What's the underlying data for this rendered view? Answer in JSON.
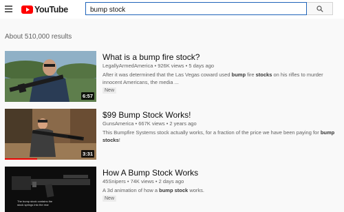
{
  "app": {
    "logo_text": "YouTube"
  },
  "search": {
    "query": "bump stock"
  },
  "results_count": "About 510,000 results",
  "results": [
    {
      "title": "What is a bump fire stock?",
      "channel": "LegallyArmedAmerica",
      "views": "926K views",
      "age": "5 days ago",
      "desc_parts": [
        "After it was determined that the Las Vegas coward used ",
        "bump",
        " fire ",
        "stocks",
        " on his rifles to murder innocent Americans, the media ..."
      ],
      "badge": "New",
      "duration": "6:57",
      "watched_fraction": 0
    },
    {
      "title": "$99 Bump Stock Works!",
      "channel": "GunsAmerica",
      "views": "667K views",
      "age": "2 years ago",
      "desc_parts": [
        "This Bumpfire Systems stock actually works, for a fraction of the price we have been paying for ",
        "bump",
        " ",
        "stocks",
        "!"
      ],
      "badge": "",
      "duration": "3:31",
      "watched_fraction": 0.35
    },
    {
      "title": "How A Bump Stock Works",
      "channel": "45Snipers",
      "views": "74K views",
      "age": "2 days ago",
      "desc_parts": [
        "A 3d animation of how a ",
        "bump stock",
        " works.",
        "",
        ""
      ],
      "badge": "New",
      "duration": "",
      "watched_fraction": 0,
      "thumb_caption": "The bump stock contains the stock springs into the rear"
    }
  ],
  "icons": {
    "menu": "hamburger-menu-icon",
    "search": "search-icon"
  },
  "colors": {
    "brand_red": "#ff0000",
    "search_border": "#1c62b9",
    "progress_red": "#ee0000"
  }
}
